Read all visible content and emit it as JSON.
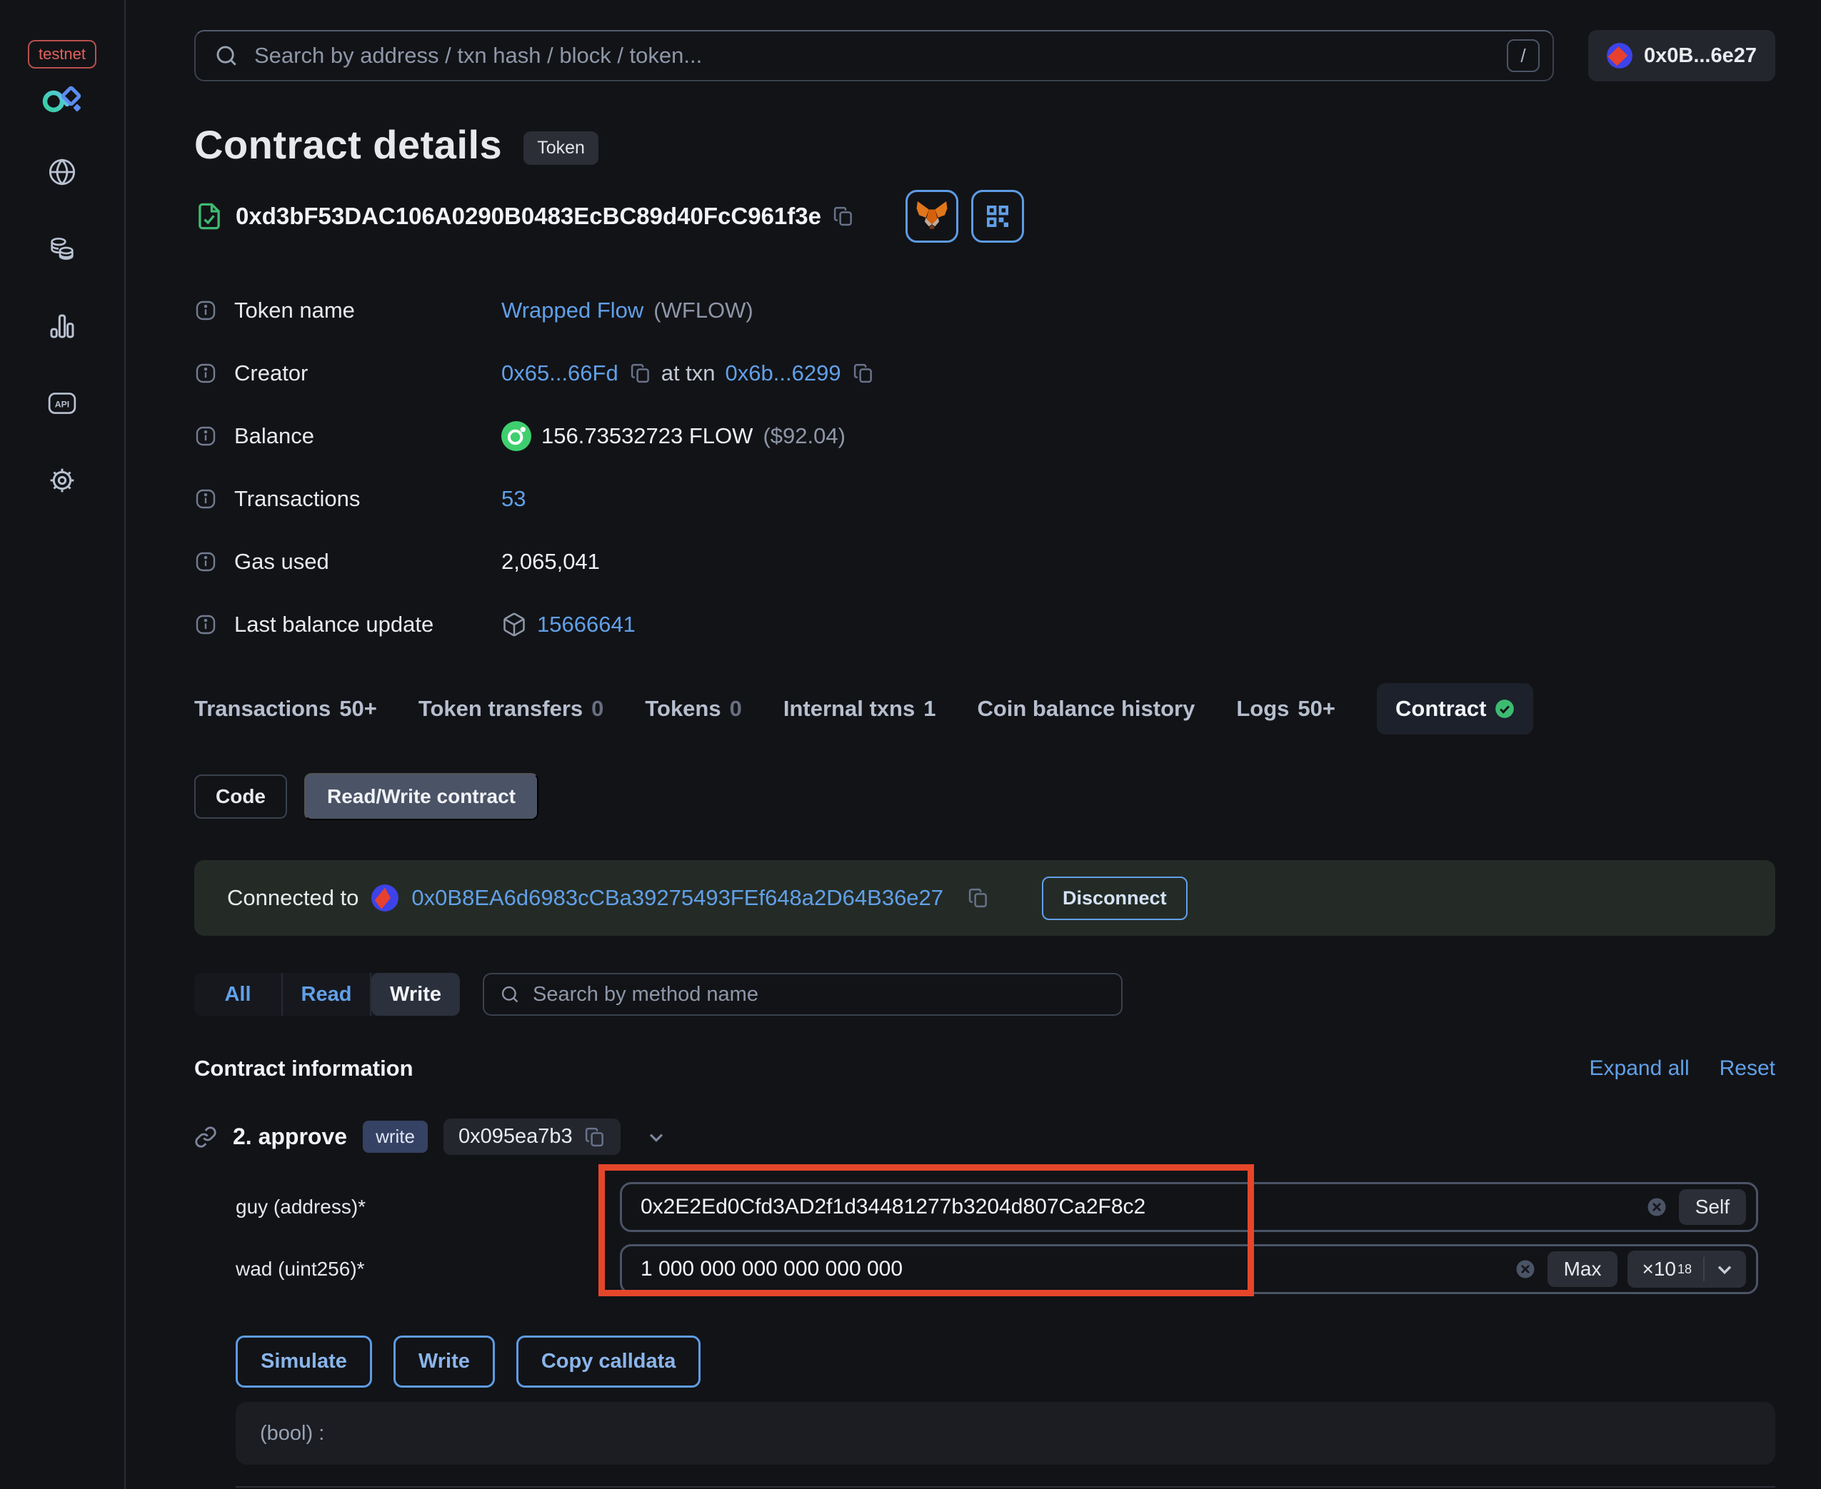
{
  "colors": {
    "accent_blue": "#61a0e8",
    "green": "#3dbb72",
    "annotation_red": "#e5462a",
    "testnet_red": "#e2625c"
  },
  "sidebar": {
    "network_badge": "testnet"
  },
  "header": {
    "search_placeholder": "Search by address / txn hash / block / token...",
    "shortcut_hint": "/",
    "account_address": "0x0B...6e27"
  },
  "page": {
    "title": "Contract details",
    "type_badge": "Token",
    "contract_address": "0xd3bF53DAC106A0290B0483EcBC89d40FcC961f3e"
  },
  "info": {
    "token_name": {
      "label": "Token name",
      "value": "Wrapped Flow",
      "symbol": "(WFLOW)"
    },
    "creator": {
      "label": "Creator",
      "address": "0x65...66Fd",
      "at_txn": "at txn",
      "txn": "0x6b...6299"
    },
    "balance": {
      "label": "Balance",
      "amount": "156.73532723 FLOW",
      "usd": "($92.04)"
    },
    "transactions": {
      "label": "Transactions",
      "value": "53"
    },
    "gas_used": {
      "label": "Gas used",
      "value": "2,065,041"
    },
    "last_balance_update": {
      "label": "Last balance update",
      "value": "15666641"
    }
  },
  "tabs": [
    {
      "label": "Transactions",
      "count": "50+"
    },
    {
      "label": "Token transfers",
      "count": "0"
    },
    {
      "label": "Tokens",
      "count": "0"
    },
    {
      "label": "Internal txns",
      "count": "1"
    },
    {
      "label": "Coin balance history",
      "count": ""
    },
    {
      "label": "Logs",
      "count": "50+"
    },
    {
      "label": "Contract",
      "count": ""
    }
  ],
  "subtabs": {
    "code": "Code",
    "read_write": "Read/Write contract"
  },
  "connection": {
    "label": "Connected to",
    "address": "0x0B8EA6d6983cCBa39275493FEf648a2D64B36e27",
    "disconnect": "Disconnect"
  },
  "filters": {
    "all": "All",
    "read": "Read",
    "write": "Write",
    "search_placeholder": "Search by method name"
  },
  "section": {
    "title": "Contract information",
    "expand_all": "Expand all",
    "reset": "Reset"
  },
  "method": {
    "name": "2. approve",
    "badge": "write",
    "selector": "0x095ea7b3",
    "fields": [
      {
        "label": "guy (address)*",
        "value": "0x2E2Ed0Cfd3AD2f1d34481277b3204d807Ca2F8c2",
        "action": "Self"
      },
      {
        "label": "wad (uint256)*",
        "value": "1 000 000 000 000 000 000",
        "action": "Max",
        "multiplier": "×10",
        "exponent": "18"
      }
    ],
    "actions": {
      "simulate": "Simulate",
      "write": "Write",
      "copy_calldata": "Copy calldata"
    },
    "output": "(bool) :"
  }
}
